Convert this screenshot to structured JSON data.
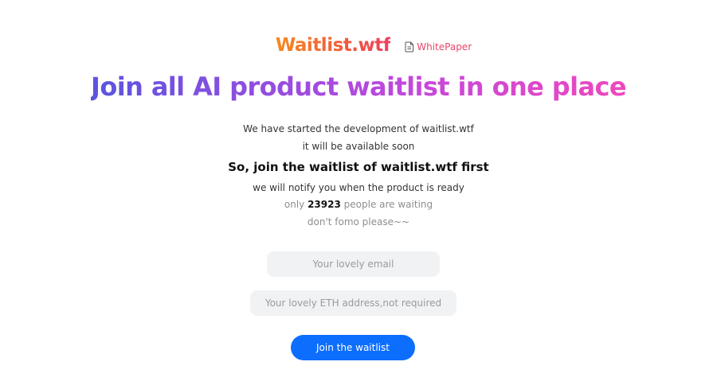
{
  "header": {
    "logo": "Waitlist.wtf",
    "whitepaper_label": "WhitePaper",
    "whitepaper_icon": "document-icon"
  },
  "headline": "Join all AI product waitlist in one place",
  "intro": {
    "line1": "We have started the development of waitlist.wtf",
    "line2": "it will be available soon",
    "cta_heading": "So, join the waitlist of waitlist.wtf first",
    "line3": "we will notify you when the product is ready",
    "waiting_prefix": "only",
    "waiting_count": "23923",
    "waiting_suffix": "people are waiting",
    "line4": "don't fomo please~~"
  },
  "form": {
    "email_placeholder": "Your lovely email",
    "email_value": "",
    "eth_placeholder": "Your lovely ETH address,not required",
    "eth_value": "",
    "submit_label": "Join the waitlist"
  },
  "colors": {
    "logo_gradient": [
      "#f58a1f",
      "#ef3f5f"
    ],
    "headline_gradient": [
      "#5a55e0",
      "#ee48bd"
    ],
    "whitepaper": "#e8476b",
    "button": "#0d6efd",
    "input_bg": "#f1f2f4"
  }
}
